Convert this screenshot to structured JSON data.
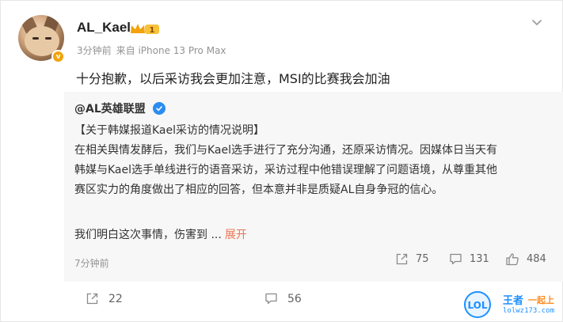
{
  "post": {
    "username": "AL_Kael",
    "member_level": "1",
    "time": "3分钟前",
    "source": "来自 iPhone 13 Pro Max",
    "text": "十分抱歉，以后采访我会更加注意，MSI的比赛我会加油"
  },
  "repost": {
    "author": "@AL英雄联盟",
    "lines": [
      "【关于韩媒报道Kael采访的情况说明】",
      "在相关舆情发酵后，我们与Kael选手进行了充分沟通，还原采访情况。因媒体日当天有",
      "韩媒与Kael选手单线进行的语音采访，采访过程中他错误理解了问题语境，从尊重其他",
      "赛区实力的角度做出了相应的回答，但本意并非是质疑AL自身争冠的信心。"
    ],
    "truncated_text": "我们明白这次事情，伤害到 ...",
    "expand_label": "展开",
    "time": "7分钟前",
    "reposts": "75",
    "comments": "131",
    "likes": "484"
  },
  "actions": {
    "reposts": "22",
    "comments": "56"
  },
  "watermark": {
    "logo": "LOL",
    "text1": "王者",
    "text2": "一起上",
    "url": "lolwz173.com"
  },
  "icons": [
    "chevron-down-icon",
    "repost-icon",
    "comment-icon",
    "like-icon",
    "crown-icon",
    "verified-icon"
  ],
  "colors": {
    "expand": "#eb7350",
    "verified": "#2b8cf2",
    "member": "#f2a20c"
  }
}
